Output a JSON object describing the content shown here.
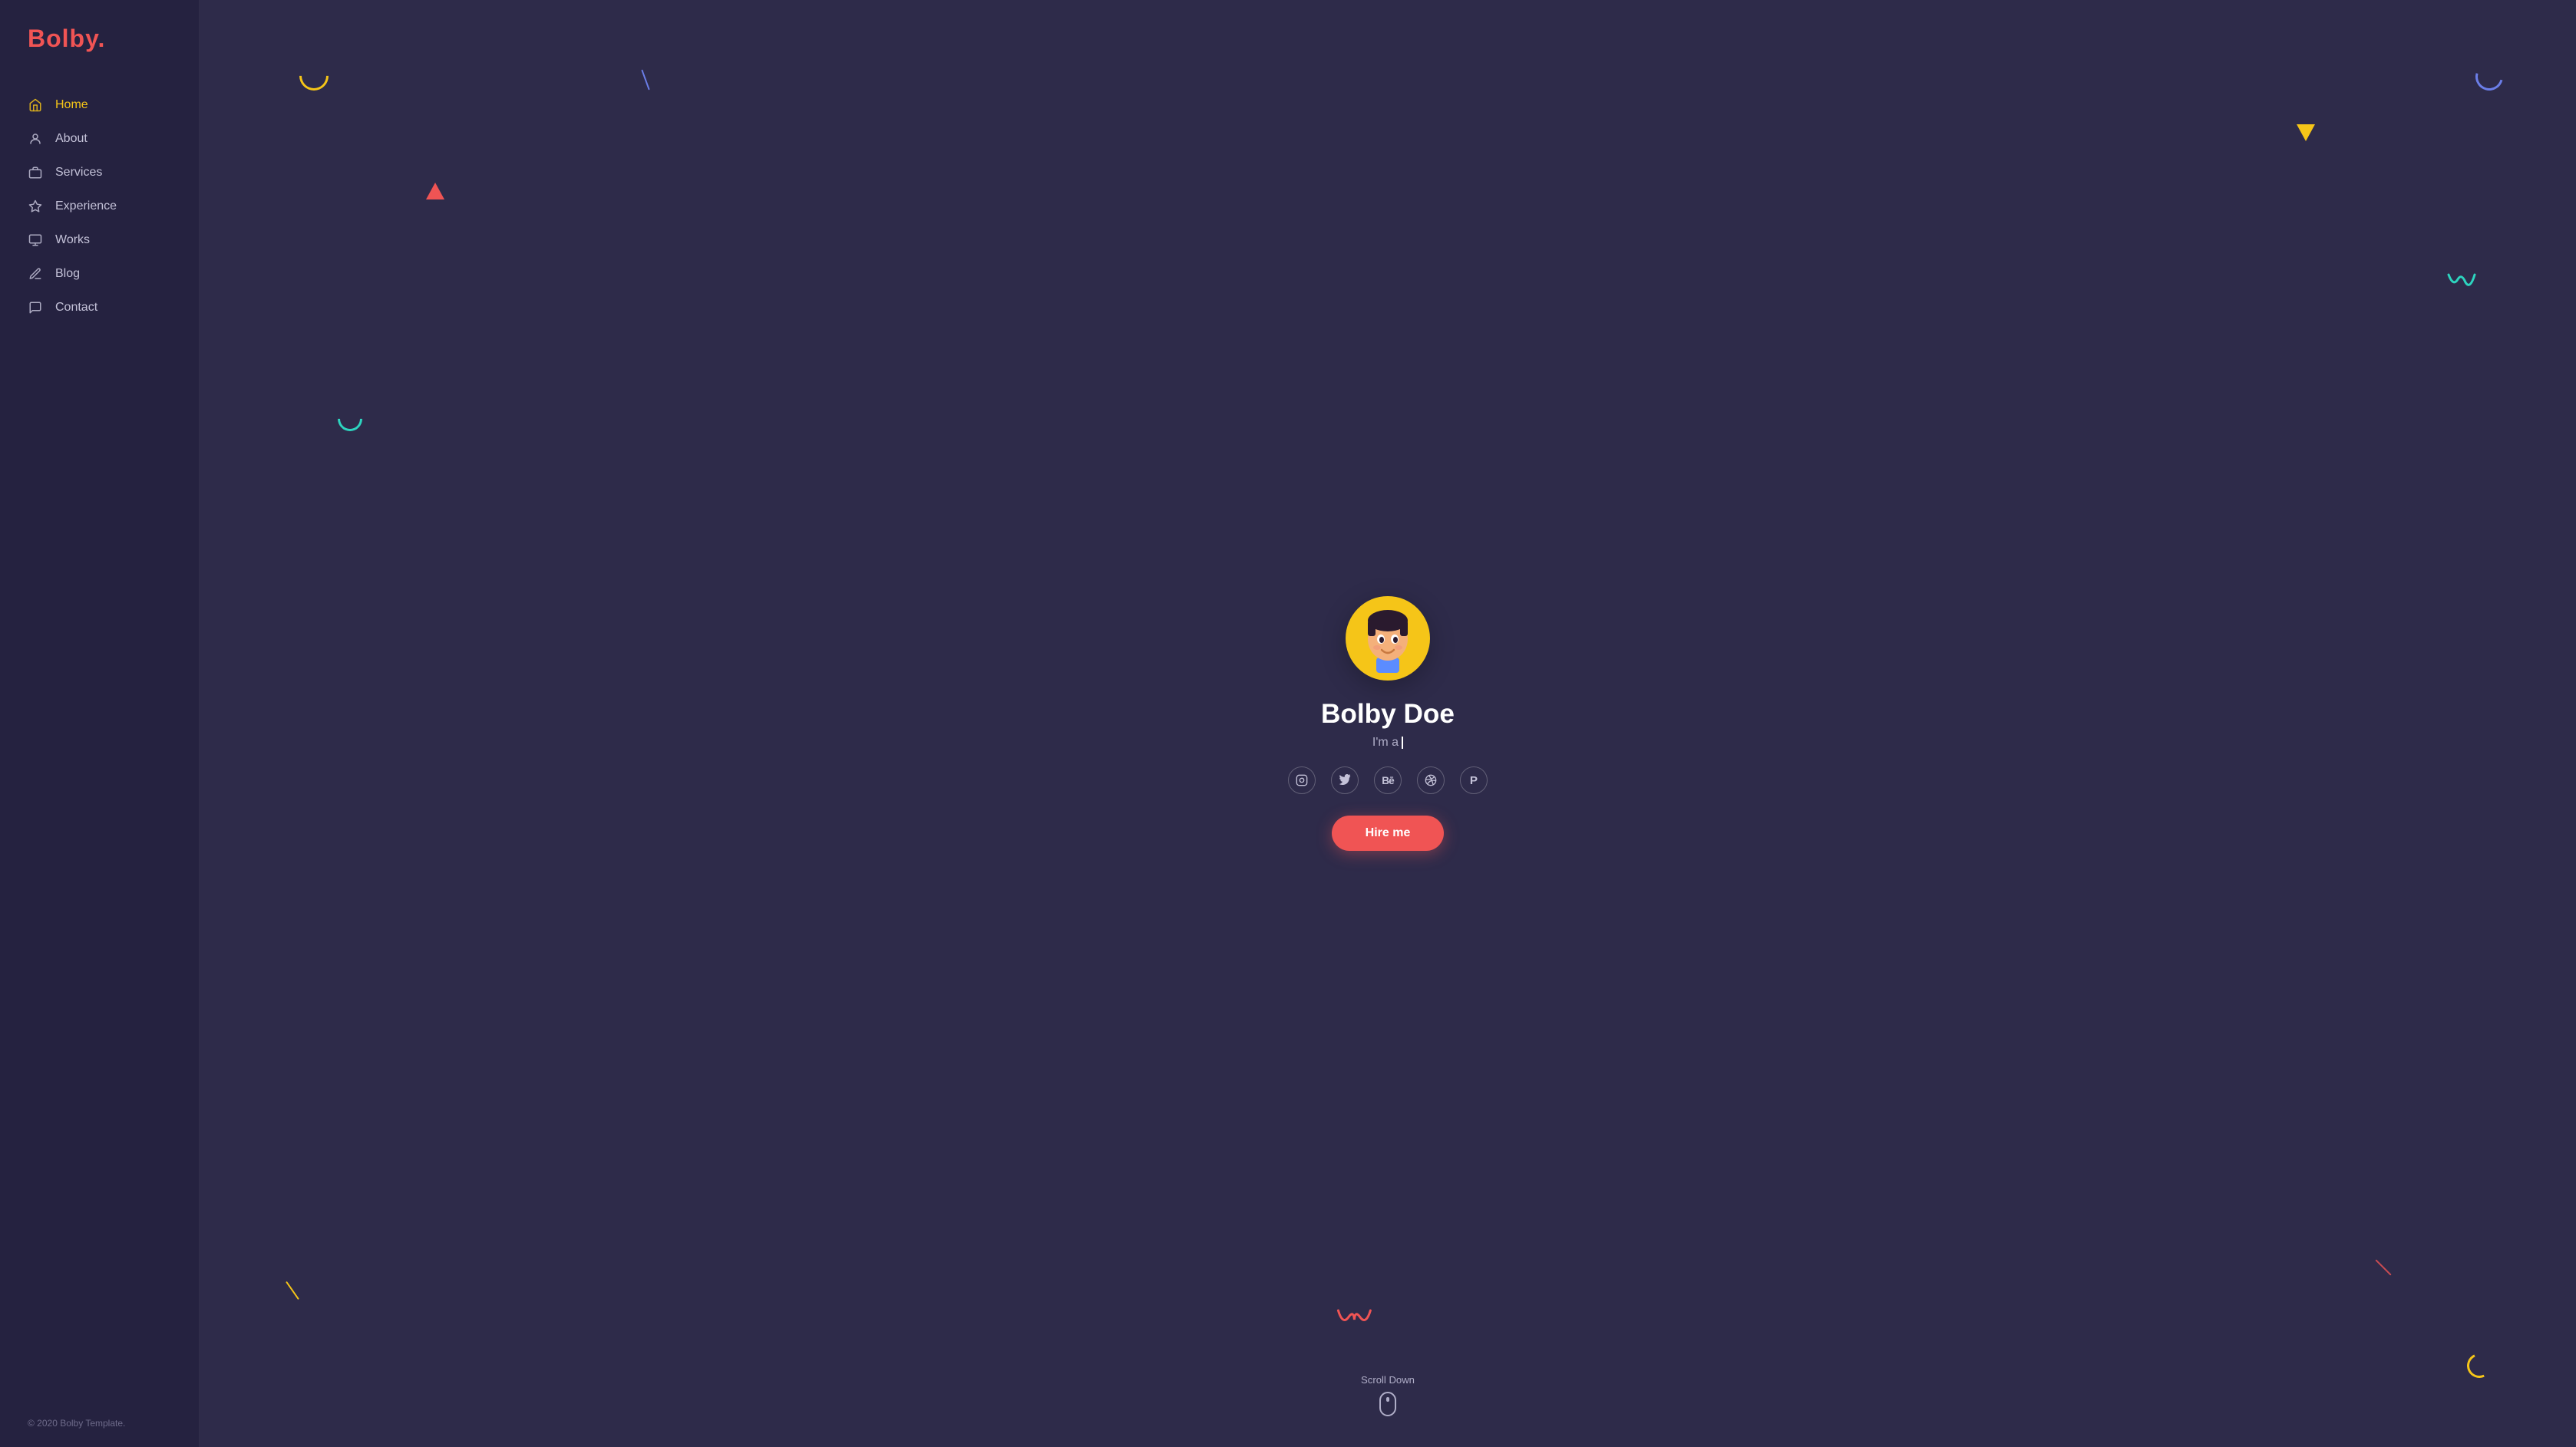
{
  "logo": {
    "text": "Bolby",
    "dot": "."
  },
  "nav": {
    "items": [
      {
        "id": "home",
        "label": "Home",
        "icon": "🏠",
        "active": true
      },
      {
        "id": "about",
        "label": "About",
        "icon": "👤",
        "active": false
      },
      {
        "id": "services",
        "label": "Services",
        "icon": "💼",
        "active": false
      },
      {
        "id": "experience",
        "label": "Experience",
        "icon": "🎓",
        "active": false
      },
      {
        "id": "works",
        "label": "Works",
        "icon": "📚",
        "active": false
      },
      {
        "id": "blog",
        "label": "Blog",
        "icon": "✏️",
        "active": false
      },
      {
        "id": "contact",
        "label": "Contact",
        "icon": "💬",
        "active": false
      }
    ]
  },
  "footer": {
    "copyright": "© 2020 Bolby Template."
  },
  "hero": {
    "name": "Bolby Doe",
    "subtitle_prefix": "I'm a",
    "hire_label": "Hire me",
    "scroll_label": "Scroll Down"
  },
  "social": [
    {
      "id": "instagram",
      "icon": "📷",
      "label": "Instagram"
    },
    {
      "id": "twitter",
      "icon": "🐦",
      "label": "Twitter"
    },
    {
      "id": "behance",
      "icon": "Bē",
      "label": "Behance"
    },
    {
      "id": "dribbble",
      "icon": "🏀",
      "label": "Dribbble"
    },
    {
      "id": "pinterest",
      "icon": "P",
      "label": "Pinterest"
    }
  ]
}
